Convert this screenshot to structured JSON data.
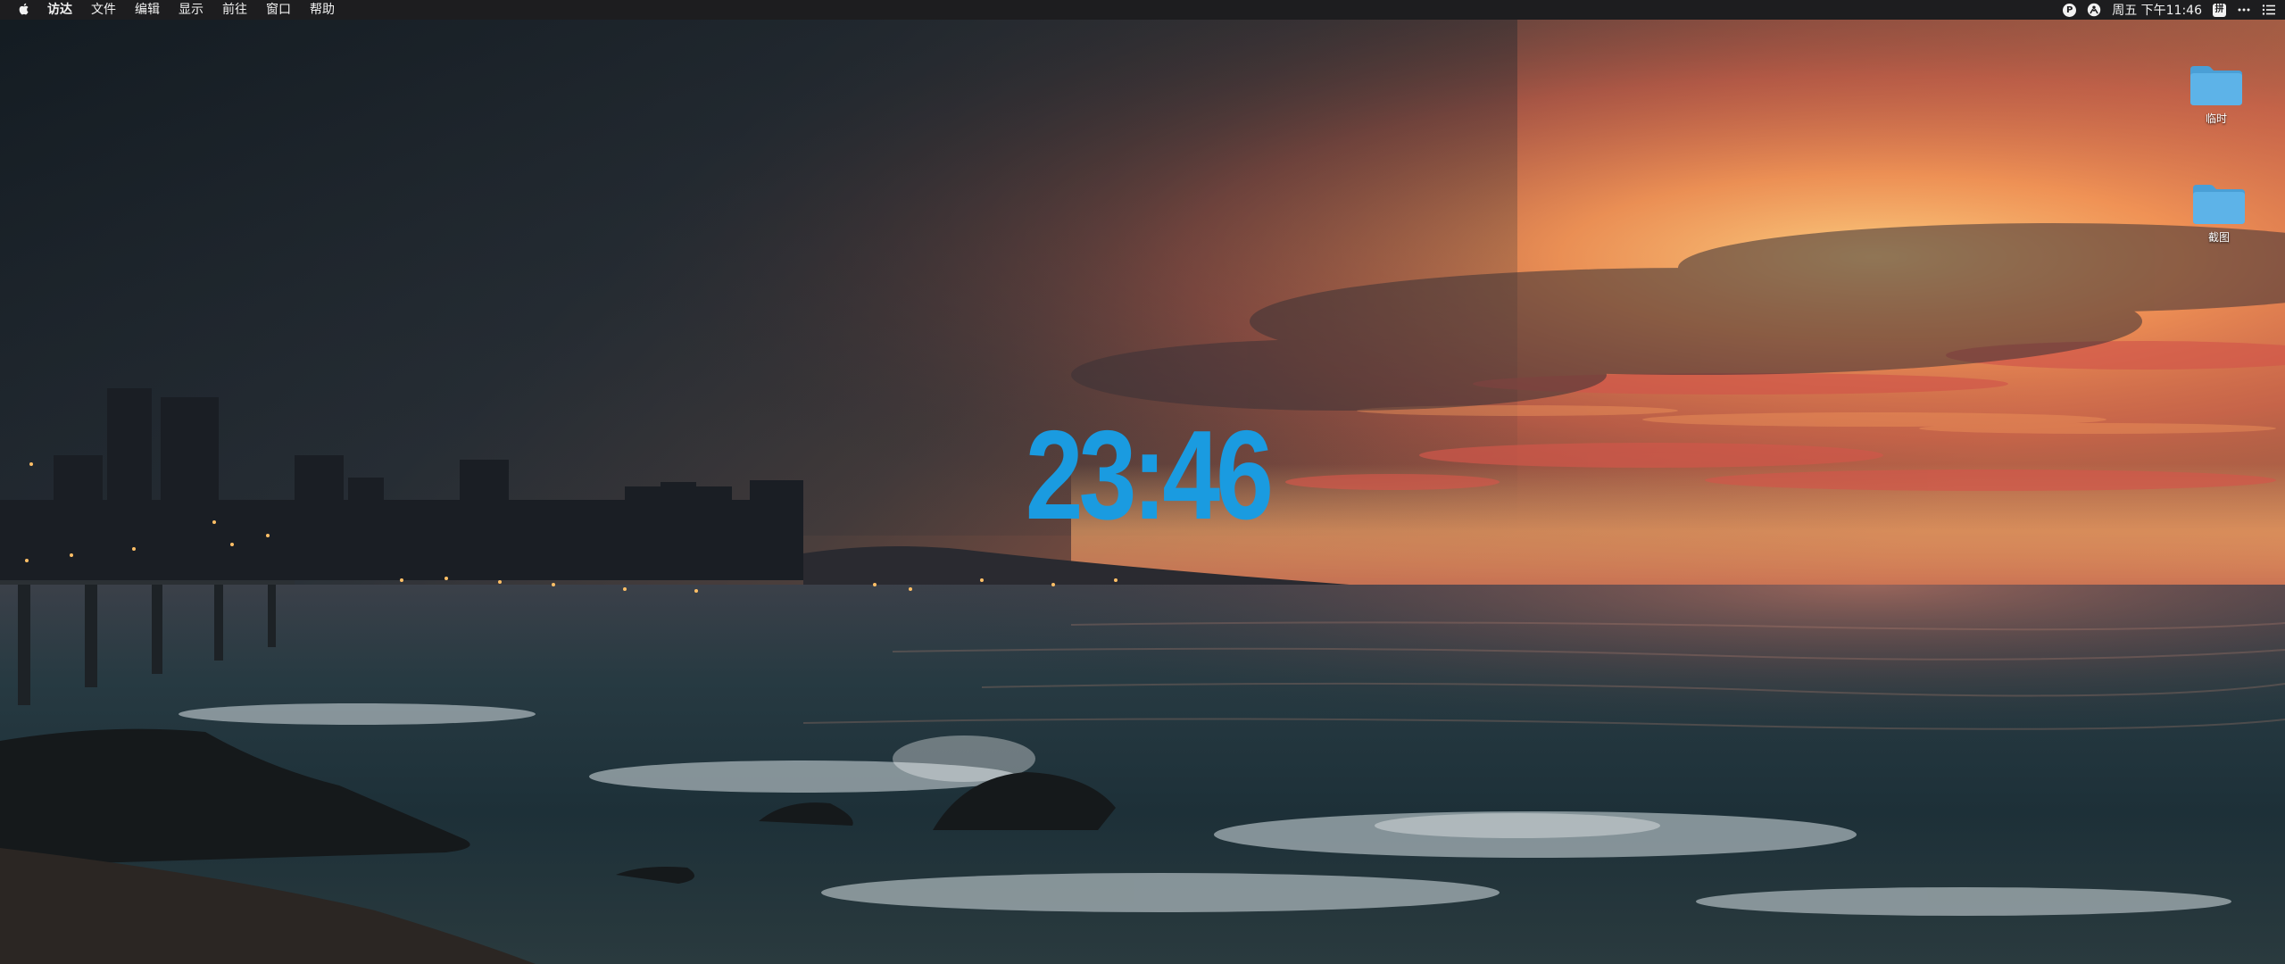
{
  "menubar": {
    "app_name": "访达",
    "items": [
      "文件",
      "编辑",
      "显示",
      "前往",
      "窗口",
      "帮助"
    ],
    "status": {
      "badge_letter": "P",
      "datetime": "周五 下午11:46",
      "ime_label": "拼"
    },
    "icons": [
      "apple-icon",
      "p-badge-icon",
      "people-icon",
      "ime-icon",
      "more-icon",
      "notification-center-icon"
    ]
  },
  "clock_widget": {
    "time": "23:46",
    "color": "#1a9be0"
  },
  "desktop_icons": [
    {
      "label": "临时",
      "icon": "folder-icon"
    },
    {
      "label": "截图",
      "icon": "folder-icon"
    }
  ],
  "colors": {
    "menubar_bg": "#1d1d1f",
    "folder_blue": "#5db3e8"
  }
}
